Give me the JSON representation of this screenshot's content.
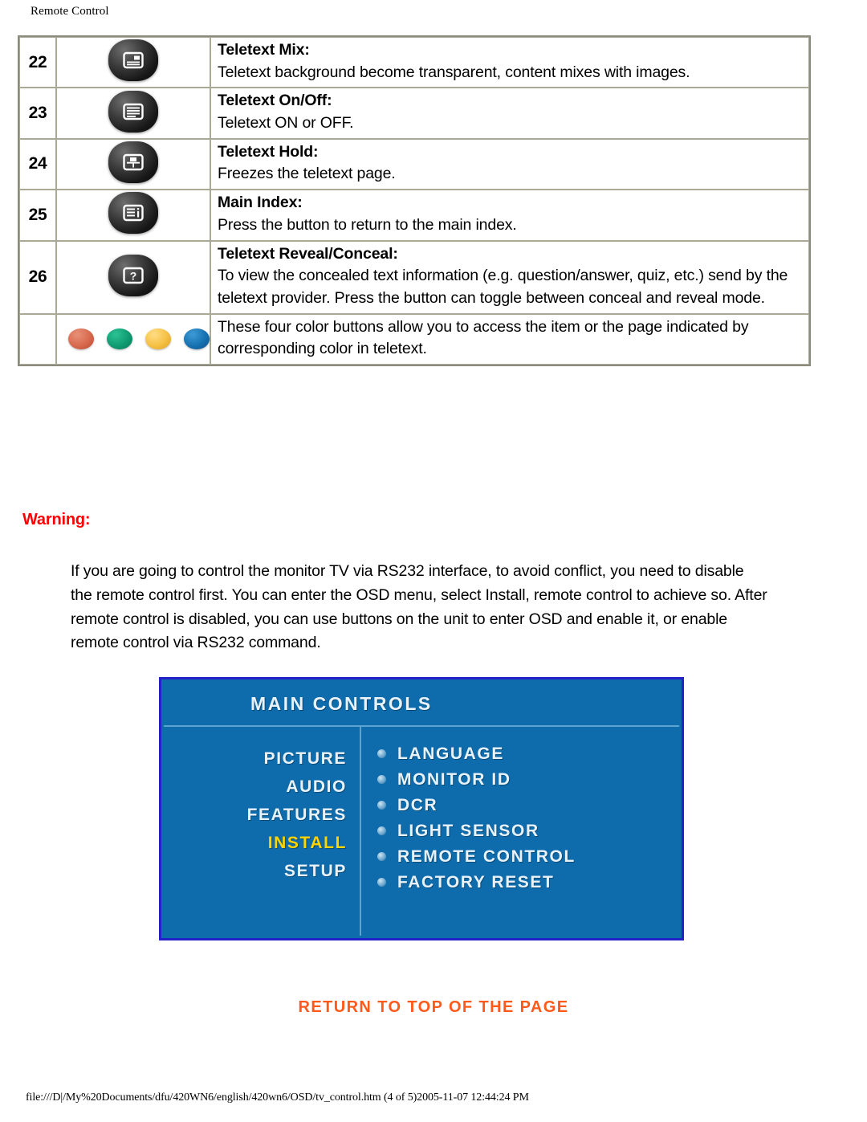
{
  "header": {
    "title": "Remote Control"
  },
  "table": {
    "rows": [
      {
        "num": "22",
        "icon": "teletext-mix-button-icon",
        "title": "Teletext Mix:",
        "body": "Teletext background become transparent, content mixes with images."
      },
      {
        "num": "23",
        "icon": "teletext-onoff-button-icon",
        "title": "Teletext On/Off:",
        "body": "Teletext ON or OFF."
      },
      {
        "num": "24",
        "icon": "teletext-hold-button-icon",
        "title": "Teletext Hold:",
        "body": "Freezes the teletext page."
      },
      {
        "num": "25",
        "icon": "main-index-button-icon",
        "title": "Main Index:",
        "body": "Press the button to return to the main index."
      },
      {
        "num": "26",
        "icon": "teletext-reveal-conceal-button-icon",
        "title": "Teletext Reveal/Conceal:",
        "body": "To view the concealed text information (e.g. question/answer, quiz, etc.) send by the teletext provider. Press the button can toggle between conceal and reveal mode."
      }
    ],
    "color_row": {
      "num": "",
      "buttons": [
        {
          "name": "red-color-button",
          "color": "#d8694e"
        },
        {
          "name": "green-color-button",
          "color": "#0f9b72"
        },
        {
          "name": "yellow-color-button",
          "color": "#f5c043"
        },
        {
          "name": "blue-color-button",
          "color": "#1671b0"
        }
      ],
      "body": "These four color buttons allow you to access the item or the page indicated by corresponding color in teletext."
    }
  },
  "warning": {
    "heading": "Warning:",
    "body": "If you are going to control the monitor TV via RS232 interface, to avoid conflict, you need to disable the remote control first. You can enter the OSD menu, select Install, remote control to achieve so. After remote control is disabled, you can use buttons on the unit to enter OSD and enable it, or enable remote control via RS232 command."
  },
  "osd": {
    "title": "MAIN  CONTROLS",
    "accent_border": "#2222c8",
    "background": "#0f6cac",
    "selected_color": "#ffd400",
    "left_items": [
      {
        "label": "PICTURE",
        "selected": false
      },
      {
        "label": "AUDIO",
        "selected": false
      },
      {
        "label": "FEATURES",
        "selected": false
      },
      {
        "label": "INSTALL",
        "selected": true
      },
      {
        "label": "SETUP",
        "selected": false
      }
    ],
    "right_items": [
      {
        "label": "LANGUAGE"
      },
      {
        "label": "MONITOR ID"
      },
      {
        "label": "DCR"
      },
      {
        "label": "LIGHT SENSOR"
      },
      {
        "label": "REMOTE CONTROL"
      },
      {
        "label": "FACTORY RESET"
      }
    ]
  },
  "return_link": {
    "label": "RETURN TO TOP OF THE PAGE",
    "color": "#ff5a1a"
  },
  "footer": {
    "text": "file:///D|/My%20Documents/dfu/420WN6/english/420wn6/OSD/tv_control.htm (4 of 5)2005-11-07 12:44:24 PM"
  }
}
